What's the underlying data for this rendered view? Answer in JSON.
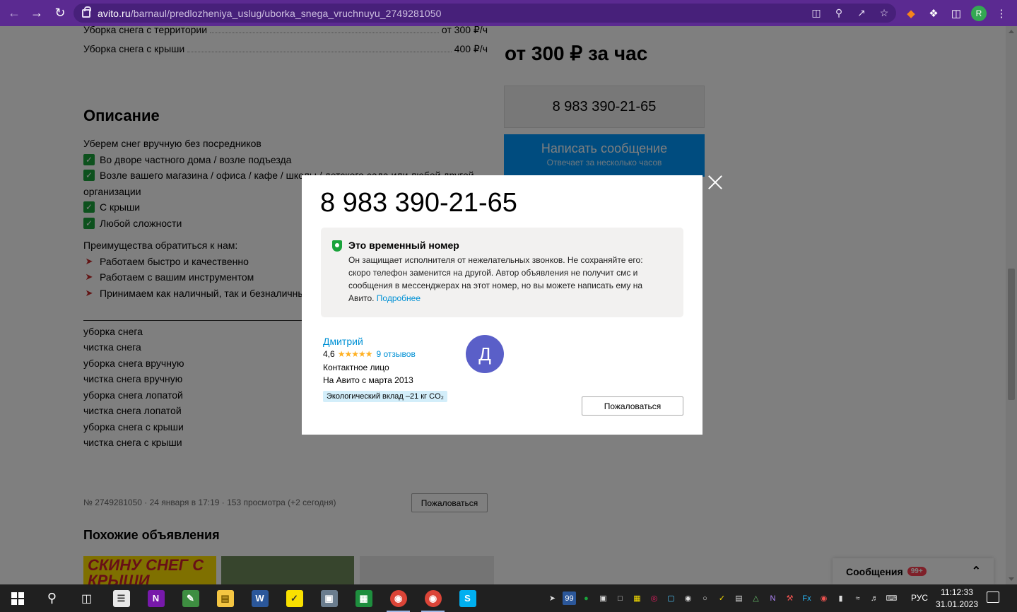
{
  "browser": {
    "url_host": "avito.ru",
    "url_path": "/barnaul/predlozheniya_uslug/uborka_snega_vruchnuyu_2749281050",
    "profile_initial": "R"
  },
  "listing": {
    "price_rows": [
      {
        "label": "Уборка снега с территории",
        "price": "от 300 ₽/ч"
      },
      {
        "label": "Уборка снега с крыши",
        "price": "400 ₽/ч"
      }
    ],
    "description_heading": "Описание",
    "description_intro": "Уберем снег вручную без посредников",
    "checks": [
      "Во дворе частного дома / возле подъезда",
      "Возле вашего магазина / офиса / кафе / школы / детского сада или любой другой",
      "организации",
      "С крыши",
      "Любой сложности"
    ],
    "advantages_heading": "Преимущества обратиться к нам:",
    "advantages": [
      "Работаем быстро и качественно",
      "Работаем с вашим инструментом",
      "Принимаем как наличный, так и безналичный расчёт"
    ],
    "tags": [
      "уборка снега",
      "чистка снега",
      "уборка снега вручную",
      "чистка снега вручную",
      "уборка снега лопатой",
      "чистка снега лопатой",
      "уборка снега с крыши",
      "чистка снега с крыши"
    ],
    "meta": "№ 2749281050 · 24 января в 17:19 · 153 просмотра (+2 сегодня)",
    "complain_label": "Пожаловаться",
    "similar_heading": "Похожие объявления",
    "thumb_text": "СКИНУ СНЕГ С КРЫШИ"
  },
  "sidebar": {
    "price": "от 300 ₽ за час",
    "phone": "8 983 390-21-65",
    "write_label": "Написать сообщение",
    "write_sub": "Отвечает за несколько часов"
  },
  "messages_bar": {
    "label": "Сообщения",
    "badge": "99+"
  },
  "modal": {
    "phone": "8 983 390-21-65",
    "notice_title": "Это временный номер",
    "notice_text": "Он защищает исполнителя от нежелательных звонков. Не сохраняйте его: скоро телефон заменится на другой. Автор объявления не получит смс и сообщения в мессенджерах на этот номер, но вы можете написать ему на Авито.",
    "notice_link": "Подробнее",
    "seller_name": "Дмитрий",
    "rating": "4,6",
    "stars": "★★★★★",
    "reviews": "9 отзывов",
    "role": "Контактное лицо",
    "since": "На Авито с марта 2013",
    "eco": "Экологический вклад –21 кг CO₂",
    "avatar_letter": "Д",
    "complain_label": "Пожаловаться"
  },
  "taskbar": {
    "lang": "РУС",
    "time": "11:12:33",
    "date": "31.01.2023",
    "tray_badge": "99"
  },
  "colors": {
    "chrome": "#5b2a91",
    "avito_blue": "#0099ff",
    "link": "#0091d5",
    "check_green": "#1aa33b",
    "avatar": "#5a5fc8"
  }
}
